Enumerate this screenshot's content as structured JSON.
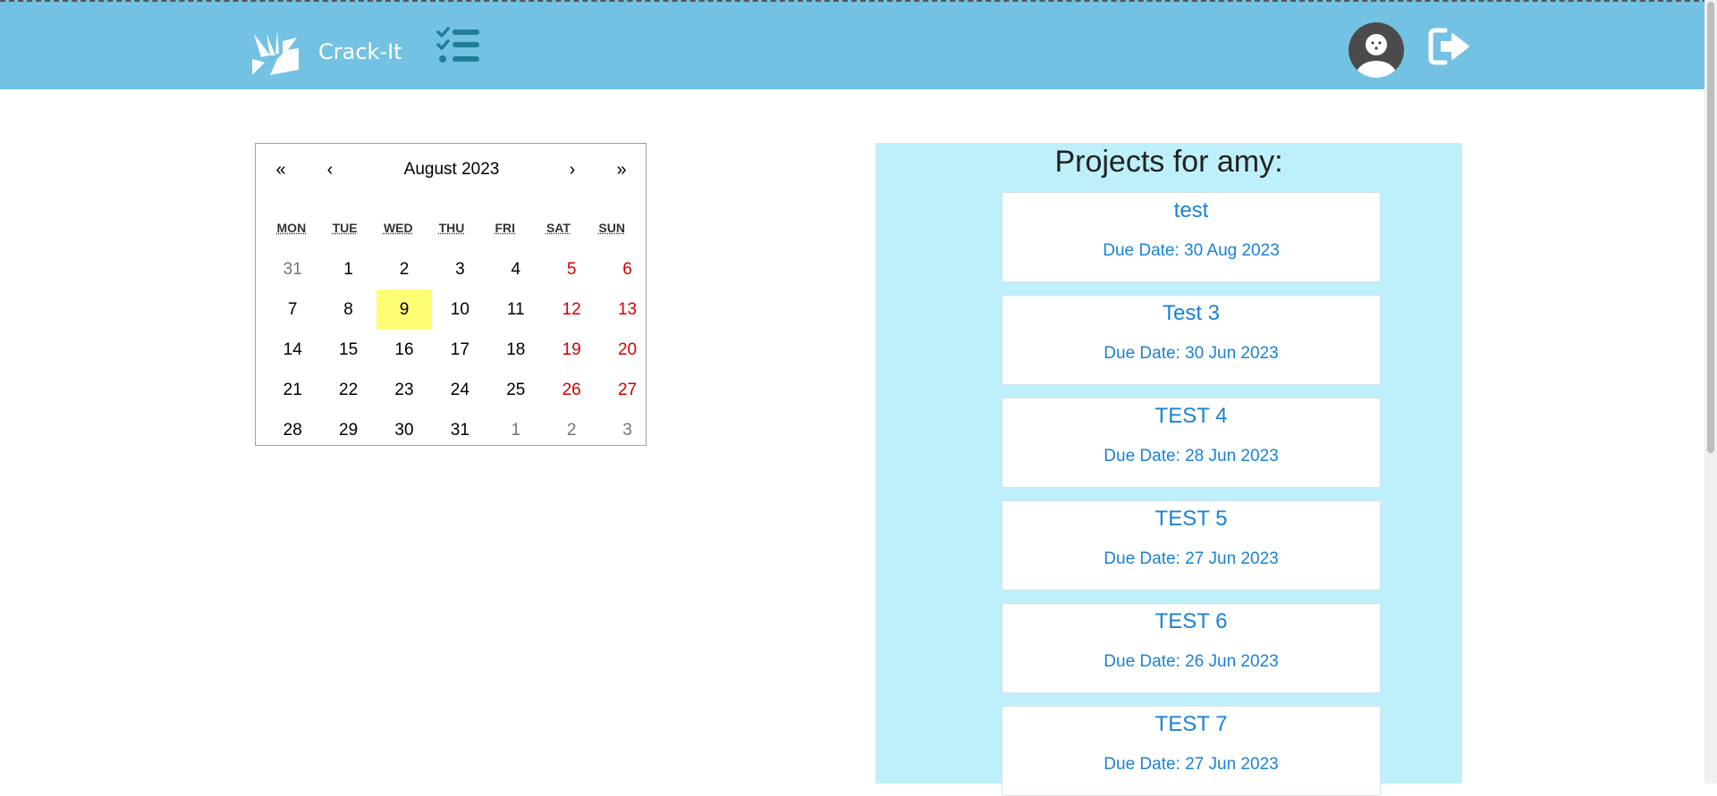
{
  "header": {
    "brand_name": "Crack-It",
    "icons": {
      "logo": "sparkle-logo-icon",
      "tasks": "checklist-icon",
      "avatar": "user-avatar",
      "logout": "logout-icon"
    },
    "colors": {
      "navbar": "#73c2e3",
      "brand_text": "#ffffff",
      "tasks_icon": "#1f7f96"
    }
  },
  "calendar": {
    "prev_year": "«",
    "prev_month": "‹",
    "month_label": "August 2023",
    "next_month": "›",
    "next_year": "»",
    "weekdays": [
      "MON",
      "TUE",
      "WED",
      "THU",
      "FRI",
      "SAT",
      "SUN"
    ],
    "days": [
      {
        "d": "31",
        "t": "other"
      },
      {
        "d": "1",
        "t": ""
      },
      {
        "d": "2",
        "t": ""
      },
      {
        "d": "3",
        "t": ""
      },
      {
        "d": "4",
        "t": ""
      },
      {
        "d": "5",
        "t": "weekend"
      },
      {
        "d": "6",
        "t": "weekend"
      },
      {
        "d": "7",
        "t": ""
      },
      {
        "d": "8",
        "t": ""
      },
      {
        "d": "9",
        "t": "today"
      },
      {
        "d": "10",
        "t": ""
      },
      {
        "d": "11",
        "t": ""
      },
      {
        "d": "12",
        "t": "weekend"
      },
      {
        "d": "13",
        "t": "weekend"
      },
      {
        "d": "14",
        "t": ""
      },
      {
        "d": "15",
        "t": ""
      },
      {
        "d": "16",
        "t": ""
      },
      {
        "d": "17",
        "t": ""
      },
      {
        "d": "18",
        "t": ""
      },
      {
        "d": "19",
        "t": "weekend"
      },
      {
        "d": "20",
        "t": "weekend"
      },
      {
        "d": "21",
        "t": ""
      },
      {
        "d": "22",
        "t": ""
      },
      {
        "d": "23",
        "t": ""
      },
      {
        "d": "24",
        "t": ""
      },
      {
        "d": "25",
        "t": ""
      },
      {
        "d": "26",
        "t": "weekend"
      },
      {
        "d": "27",
        "t": "weekend"
      },
      {
        "d": "28",
        "t": ""
      },
      {
        "d": "29",
        "t": ""
      },
      {
        "d": "30",
        "t": ""
      },
      {
        "d": "31",
        "t": ""
      },
      {
        "d": "1",
        "t": "other"
      },
      {
        "d": "2",
        "t": "other"
      },
      {
        "d": "3",
        "t": "other"
      }
    ],
    "colors": {
      "weekend": "#d10000",
      "other_month": "#757575",
      "today_highlight": "#ffff76"
    }
  },
  "projects": {
    "title": "Projects for amy:",
    "panel_color": "#bdf0fb",
    "link_color": "#1a82d6",
    "items": [
      {
        "name": "test",
        "due": "Due Date: 30 Aug 2023"
      },
      {
        "name": "Test 3",
        "due": "Due Date: 30 Jun 2023"
      },
      {
        "name": "TEST 4",
        "due": "Due Date: 28 Jun 2023"
      },
      {
        "name": "TEST 5",
        "due": "Due Date: 27 Jun 2023"
      },
      {
        "name": "TEST 6",
        "due": "Due Date: 26 Jun 2023"
      },
      {
        "name": "TEST 7",
        "due": "Due Date: 27 Jun 2023"
      }
    ]
  }
}
